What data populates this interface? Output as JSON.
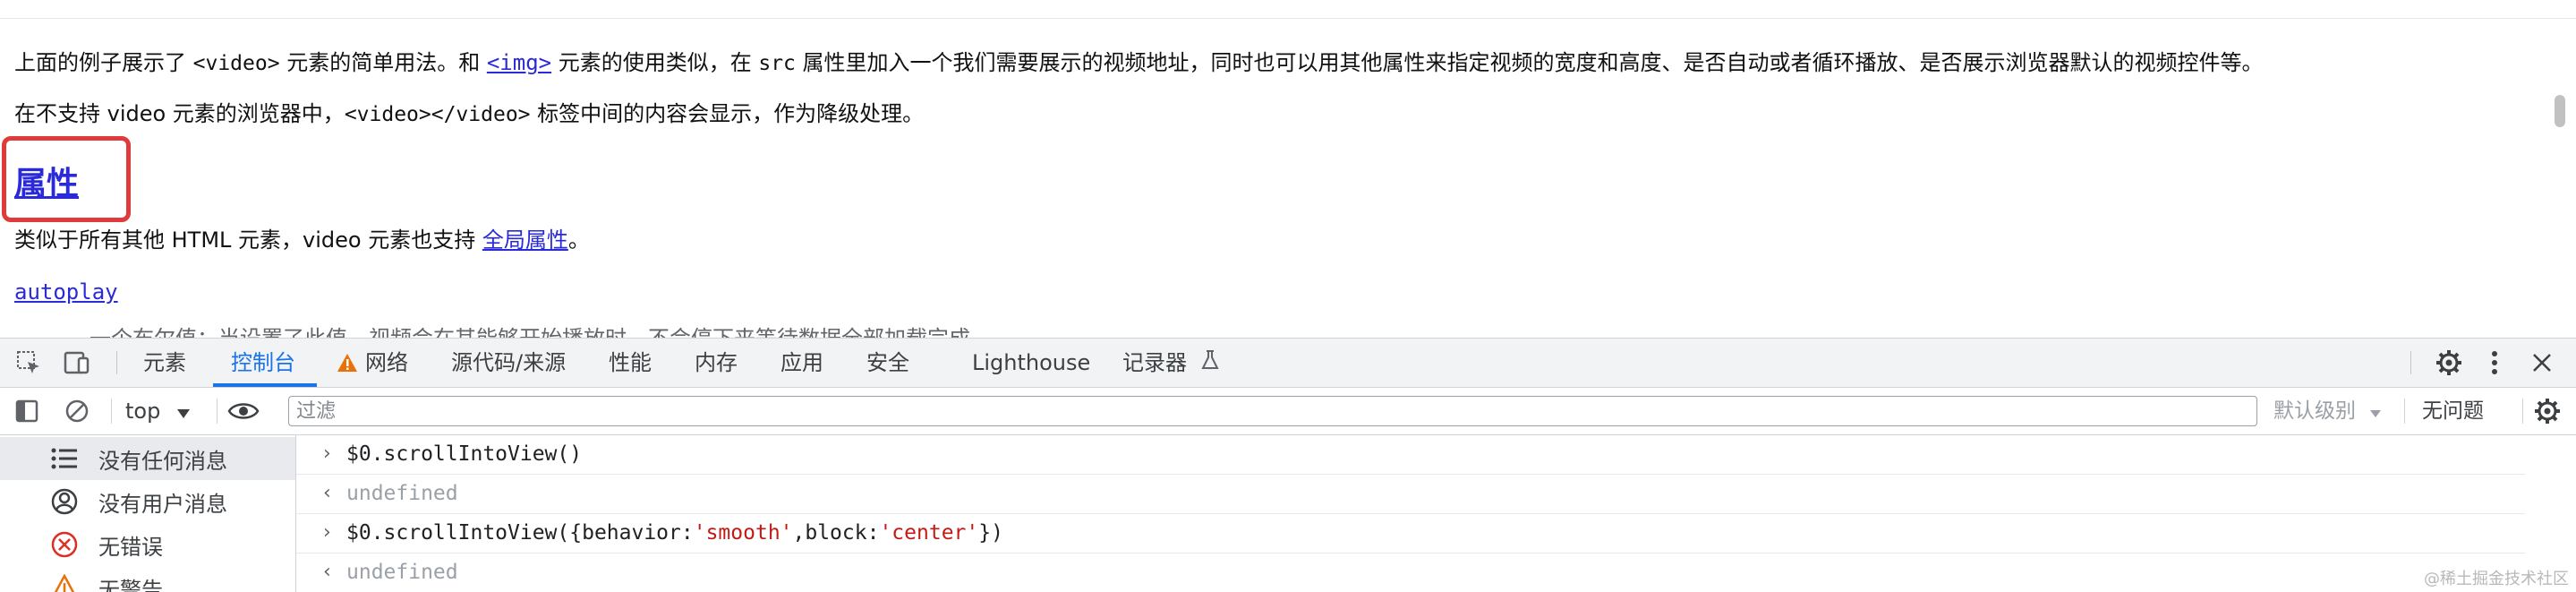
{
  "page": {
    "p1": {
      "before": "上面的例子展示了 ",
      "video_tag": "<video>",
      "mid1": " 元素的简单用法。和 ",
      "img_link": "<img>",
      "mid2": " 元素的使用类似，在 ",
      "src_code": "src",
      "after": " 属性里加入一个我们需要展示的视频地址，同时也可以用其他属性来指定视频的宽度和高度、是否自动或者循环播放、是否展示浏览器默认的视频控件等。"
    },
    "p2": {
      "before": "在不支持 video 元素的浏览器中，",
      "tag_code": "<video></video>",
      "after": " 标签中间的内容会显示，作为降级处理。"
    },
    "heading": "属性",
    "p3": {
      "before": "类似于所有其他 HTML 元素，video 元素也支持 ",
      "link": "全局属性",
      "after": "。"
    },
    "autoplay_link": "autoplay",
    "cut_text": "一个布尔值；当设置了此值，视频会在其能够开始播放时，不会停下来等待数据全部加载完成。"
  },
  "devtools": {
    "tabs": [
      "元素",
      "控制台",
      "网络",
      "源代码/来源",
      "性能",
      "内存",
      "应用",
      "安全",
      "Lighthouse",
      "记录器"
    ],
    "active_tab": "控制台",
    "toolbar": {
      "context": "top",
      "filter_placeholder": "过滤",
      "level": "默认级别",
      "issues": "无问题"
    },
    "sidebar": [
      {
        "label": "没有任何消息",
        "icon": "list-icon"
      },
      {
        "label": "没有用户消息",
        "icon": "user-icon"
      },
      {
        "label": "无错误",
        "icon": "error-icon"
      },
      {
        "label": "无警告",
        "icon": "warning-icon"
      }
    ],
    "console": [
      {
        "type": "input",
        "text": "$0.scrollIntoView()"
      },
      {
        "type": "result",
        "text": "undefined"
      },
      {
        "type": "input",
        "pre": "$0.scrollIntoView({behavior:",
        "s1": "'smooth'",
        "mid": ",block:",
        "s2": "'center'",
        "post": "})"
      },
      {
        "type": "result",
        "text": "undefined"
      }
    ]
  },
  "watermark": "@稀土掘金技术社区",
  "colors": {
    "accent": "#1a73e8",
    "link": "#2a2ad8",
    "highlight_box": "#e03b3b",
    "string": "#c41a16",
    "warning": "#e8710a",
    "error": "#d93025"
  }
}
